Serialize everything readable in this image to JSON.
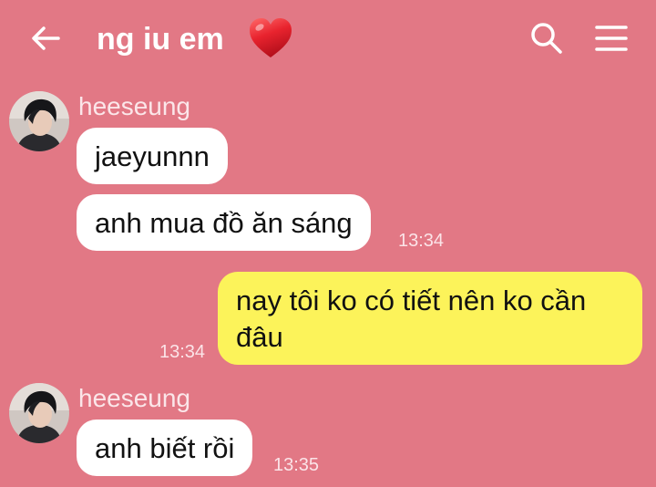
{
  "header": {
    "title": "ng iu em",
    "back_icon": "arrow-left-icon",
    "title_icon": "red-heart-icon",
    "search_icon": "search-icon",
    "menu_icon": "hamburger-menu-icon"
  },
  "colors": {
    "background": "#e27885",
    "incoming_bubble": "#ffffff",
    "outgoing_bubble": "#fcf35a",
    "heart": "#e8232e"
  },
  "messages": [
    {
      "sender": "heeseung",
      "texts": [
        "jaeyunnn",
        "anh mua đồ ăn sáng"
      ],
      "time": "13:34"
    },
    {
      "text": "nay tôi ko có tiết nên ko cần đâu",
      "time": "13:34"
    },
    {
      "sender": "heeseung",
      "texts": [
        "anh biết rồi"
      ],
      "time": "13:35"
    }
  ]
}
